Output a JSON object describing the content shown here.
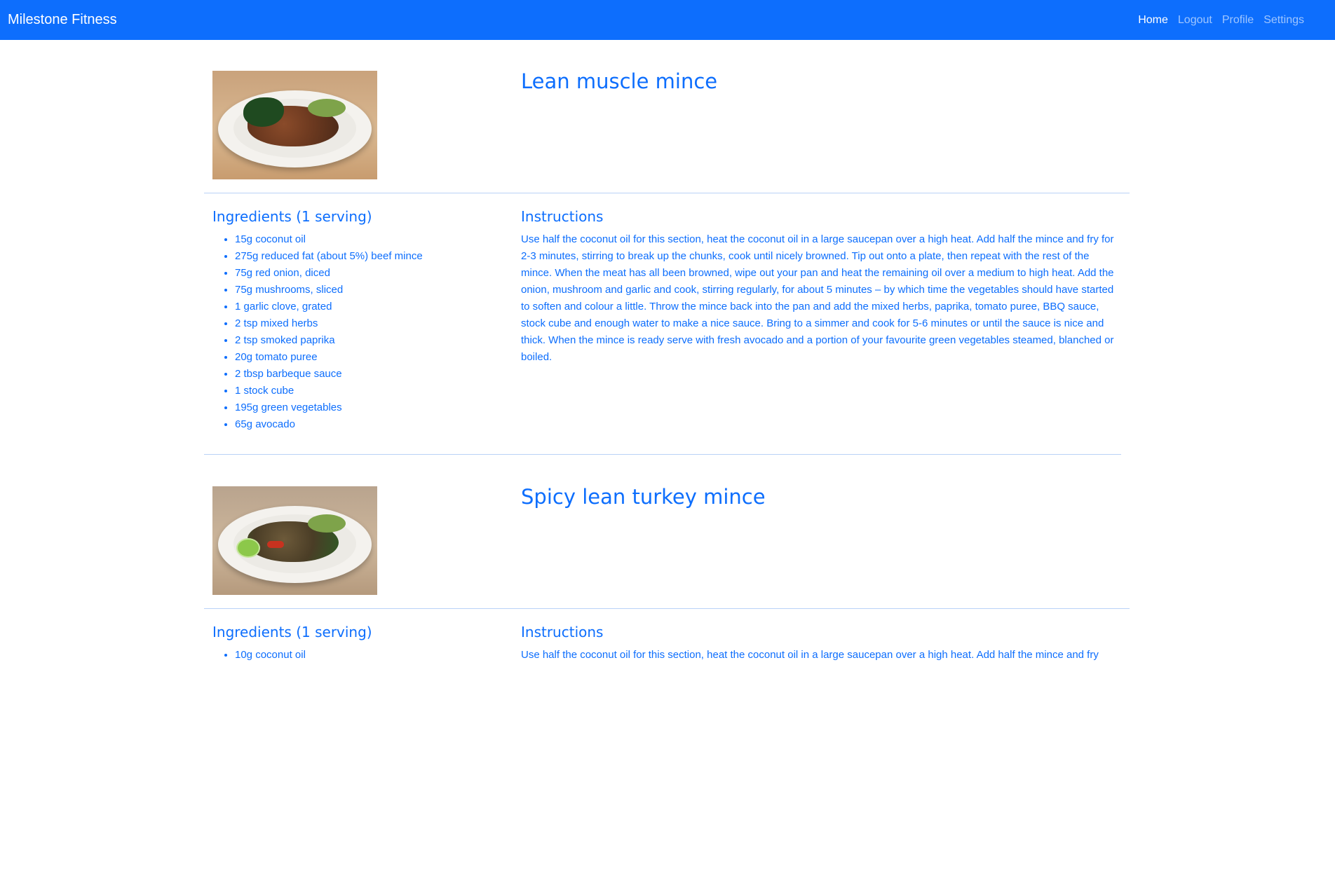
{
  "navbar": {
    "brand": "Milestone Fitness",
    "links": [
      "Home",
      "Logout",
      "Profile",
      "Settings"
    ],
    "active_link": "Home",
    "background_color": "#0d6efd"
  },
  "recipes": [
    {
      "title": "Lean muscle mince",
      "image_alt": "Plate of beef mince with greens and avocado",
      "ingredients_heading": "Ingredients (1 serving)",
      "ingredients": [
        "15g coconut oil",
        "275g reduced fat (about 5%) beef mince",
        "75g red onion, diced",
        "75g mushrooms, sliced",
        "1 garlic clove, grated",
        "2 tsp mixed herbs",
        "2 tsp smoked paprika",
        "20g tomato puree",
        "2 tbsp barbeque sauce",
        "1 stock cube",
        "195g green vegetables",
        "65g avocado"
      ],
      "instructions_heading": "Instructions",
      "instructions": "Use half the coconut oil for this section, heat the coconut oil in a large saucepan over a high heat. Add half the mince and fry for 2-3 minutes, stirring to break up the chunks, cook until nicely browned. Tip out onto a plate, then repeat with the rest of the mince. When the meat has all been browned, wipe out your pan and heat the remaining oil over a medium to high heat. Add the onion, mushroom and garlic and cook, stirring regularly, for about 5 minutes – by which time the vegetables should have started to soften and colour a little. Throw the mince back into the pan and add the mixed herbs, paprika, tomato puree, BBQ sauce, stock cube and enough water to make a nice sauce. Bring to a simmer and cook for 5-6 minutes or until the sauce is nice and thick. When the mince is ready serve with fresh avocado and a portion of your favourite green vegetables steamed, blanched or boiled."
    },
    {
      "title": "Spicy lean turkey mince",
      "image_alt": "Plate of turkey mince with lime and avocado",
      "ingredients_heading": "Ingredients (1 serving)",
      "ingredients": [
        "10g coconut oil"
      ],
      "instructions_heading": "Instructions",
      "instructions": "Use half the coconut oil for this section, heat the coconut oil in a large saucepan over a high heat. Add half the mince and fry"
    }
  ]
}
